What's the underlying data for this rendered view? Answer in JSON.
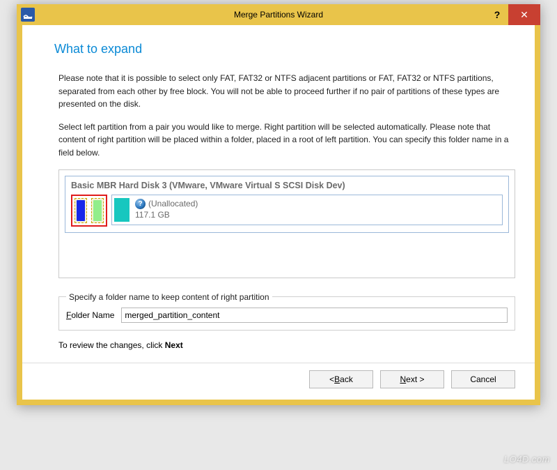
{
  "window": {
    "title": "Merge Partitions Wizard"
  },
  "page": {
    "heading": "What to expand",
    "paragraph1": "Please note that it is possible to select only FAT, FAT32 or NTFS adjacent partitions or FAT, FAT32 or NTFS partitions, separated from each other by free block. You will not be able to proceed further if no pair of partitions of these types are presented on the disk.",
    "paragraph2": "Select left partition from a pair you would like to merge. Right partition will be selected automatically. Please note that content of right partition will be placed within a folder, placed in a root of left partition. You can specify this folder name in a field below."
  },
  "disk": {
    "title": "Basic MBR Hard Disk 3 (VMware, VMware Virtual S SCSI Disk Dev)",
    "unallocated_label": "(Unallocated)",
    "unallocated_size": "117.1 GB"
  },
  "folder": {
    "legend": "Specify a folder name to keep content of right partition",
    "label_prefix": "F",
    "label_rest": "older Name",
    "value": "merged_partition_content"
  },
  "review": {
    "text_before": "To review the changes, click ",
    "bold": "Next"
  },
  "buttons": {
    "back_prefix": "< ",
    "back_ul": "B",
    "back_rest": "ack",
    "next_ul": "N",
    "next_rest": "ext >",
    "cancel": "Cancel"
  },
  "watermark": "LO4D.com"
}
